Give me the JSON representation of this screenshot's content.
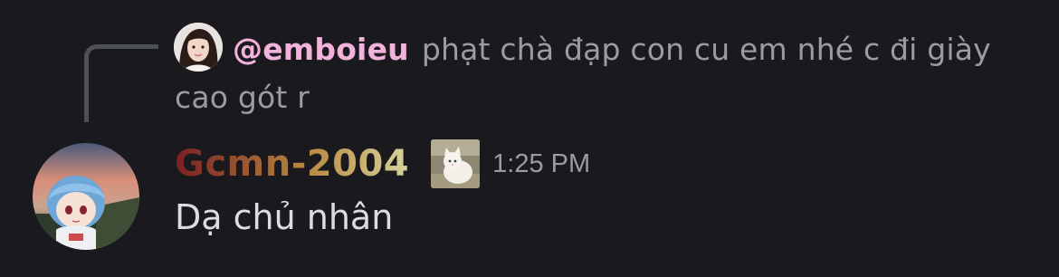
{
  "reply": {
    "username": "@emboieu",
    "text": "phạt chà đạp con cu em nhé c đi giày cao gót r",
    "avatar_icon": "girl-avatar-icon"
  },
  "message": {
    "author": "Gcmn-2004",
    "timestamp": "1:25 PM",
    "content": "Dạ chủ nhân",
    "avatar_icon": "anime-character-avatar-icon",
    "role_icon": "cat-role-icon"
  },
  "colors": {
    "background": "#1a1a1e",
    "reply_username": "#f3b2dc",
    "muted_text": "#9b9ca3",
    "message_text": "#dbdee1",
    "author_gradient": [
      "#7a1f24",
      "#b6863e",
      "#d8d39a"
    ]
  }
}
